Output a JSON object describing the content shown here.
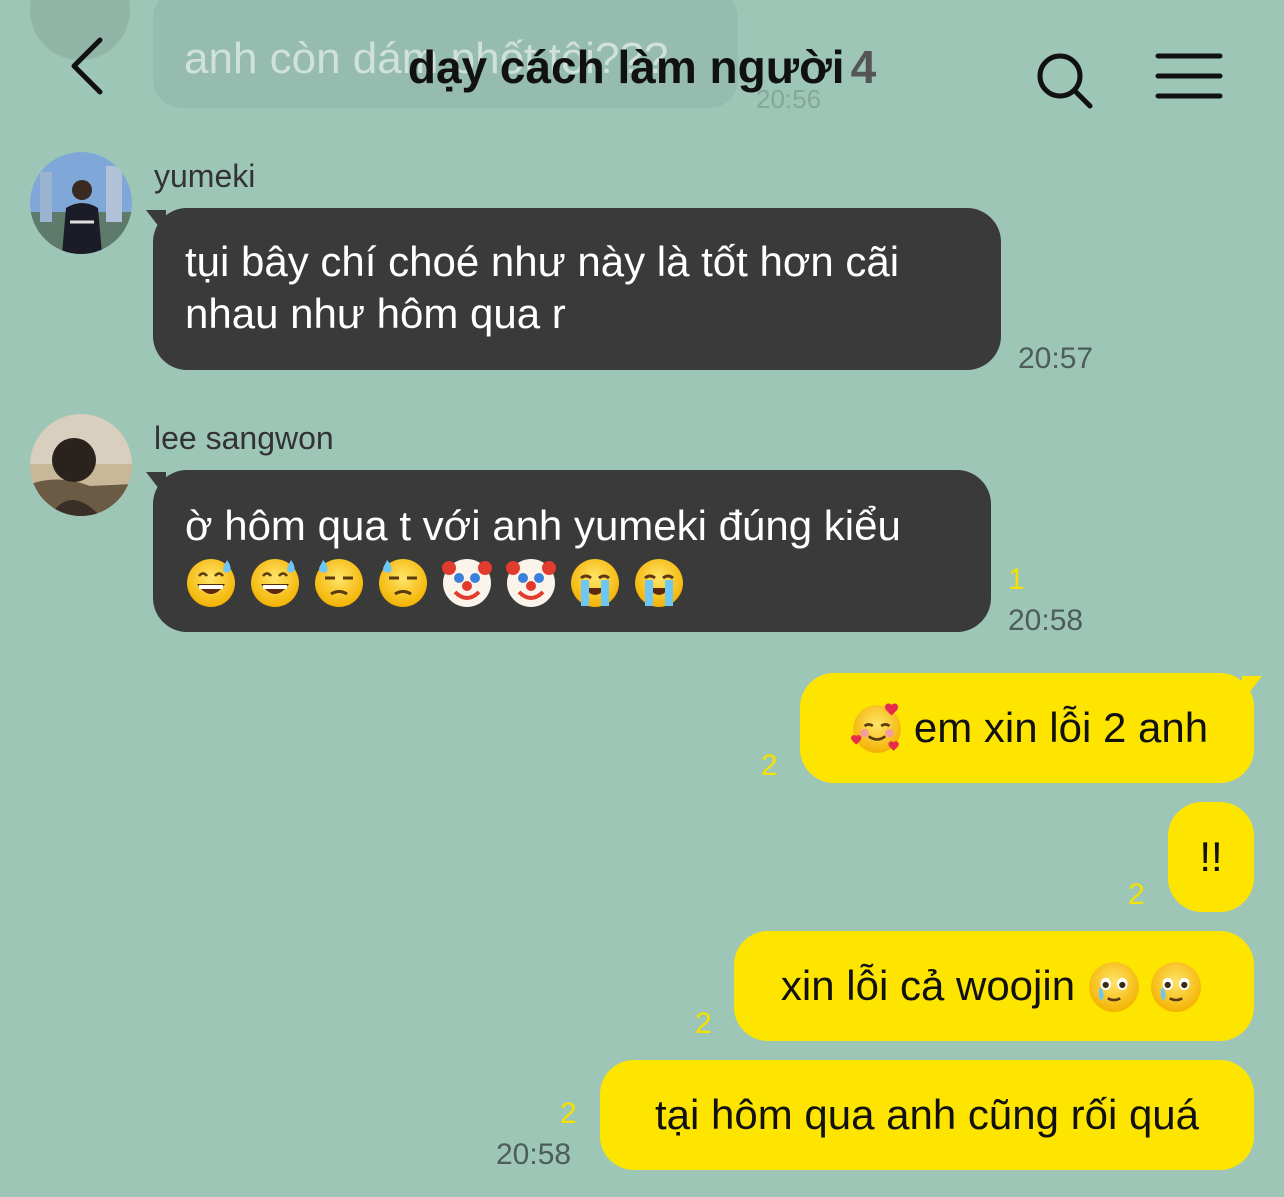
{
  "header": {
    "title": "dạy cách làm người",
    "member_count": "4",
    "back_icon": "chevron-left-icon",
    "search_icon": "search-icon",
    "menu_icon": "hamburger-menu-icon"
  },
  "faded_message": {
    "text": "anh còn dám phốt tôi???",
    "time": "20:56"
  },
  "messages": [
    {
      "sender": "yumeki",
      "text": "tụi bây chí choé như này là tốt hơn cãi nhau như hôm qua r",
      "time": "20:57"
    },
    {
      "sender": "lee sangwon",
      "text": "ờ hôm qua t với anh yumeki đúng kiểu",
      "emojis": [
        "grinning-sweat-emoji",
        "grinning-sweat-emoji",
        "downcast-sweat-emoji",
        "downcast-sweat-emoji",
        "clown-emoji",
        "clown-emoji",
        "loudly-crying-emoji",
        "loudly-crying-emoji"
      ],
      "unread": "1",
      "time": "20:58"
    }
  ],
  "my_messages": [
    {
      "text": "em xin lỗi 2 anh",
      "leading_emoji": "smiling-hearts-emoji",
      "unread": "2"
    },
    {
      "text": "!!",
      "unread": "2"
    },
    {
      "text": "xin lỗi cả woojin",
      "trailing_emojis": [
        "holding-tears-emoji",
        "holding-tears-emoji"
      ],
      "unread": "2"
    },
    {
      "text": "tại hôm qua anh cũng rối quá",
      "unread": "2",
      "time": "20:58"
    }
  ],
  "colors": {
    "background": "#9ec6b7",
    "incoming_bubble": "#3a3a3a",
    "outgoing_bubble": "#fde500",
    "unread_count": "#f5e000"
  }
}
